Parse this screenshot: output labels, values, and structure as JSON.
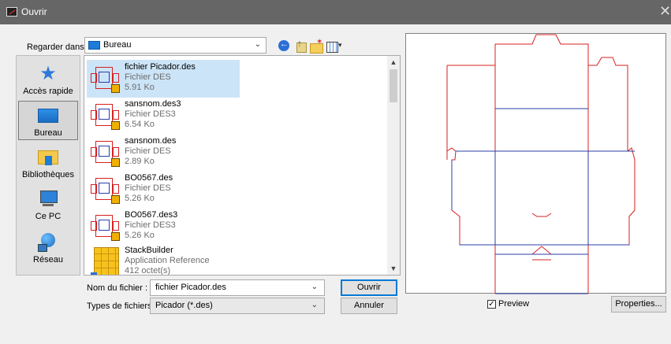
{
  "window": {
    "title": "Ouvrir",
    "close_glyph": "✕"
  },
  "lookin": {
    "label": "Regarder dans :",
    "value": "Bureau"
  },
  "toolbar": {
    "icons": [
      "back-icon",
      "up-folder-icon",
      "new-folder-icon",
      "view-menu-icon"
    ]
  },
  "places": [
    {
      "label": "Accès rapide",
      "icon": "star-icon"
    },
    {
      "label": "Bureau",
      "icon": "desktop-icon",
      "active": true
    },
    {
      "label": "Bibliothèques",
      "icon": "libraries-icon"
    },
    {
      "label": "Ce PC",
      "icon": "computer-icon"
    },
    {
      "label": "Réseau",
      "icon": "network-icon"
    }
  ],
  "files": [
    {
      "name": "fichier Picador.des",
      "type": "Fichier DES",
      "size": "5.91 Ko",
      "selected": true
    },
    {
      "name": "sansnom.des3",
      "type": "Fichier DES3",
      "size": "6.54 Ko"
    },
    {
      "name": "sansnom.des",
      "type": "Fichier DES",
      "size": "2.89 Ko"
    },
    {
      "name": "BO0567.des",
      "type": "Fichier DES",
      "size": "5.26 Ko"
    },
    {
      "name": "BO0567.des3",
      "type": "Fichier DES3",
      "size": "5.26 Ko"
    },
    {
      "name": "StackBuilder",
      "type": "Application Reference",
      "size": "412 octet(s)"
    }
  ],
  "filename": {
    "label": "Nom du fichier :",
    "value": "fichier Picador.des"
  },
  "filetype": {
    "label": "Types de fichiers :",
    "value": "Picador (*.des)"
  },
  "buttons": {
    "open": "Ouvrir",
    "cancel": "Annuler",
    "properties": "Properties..."
  },
  "preview": {
    "checkbox_label": "Preview",
    "checked": true,
    "cut_color": "#d62020",
    "fold_color": "#2b3fa8"
  }
}
